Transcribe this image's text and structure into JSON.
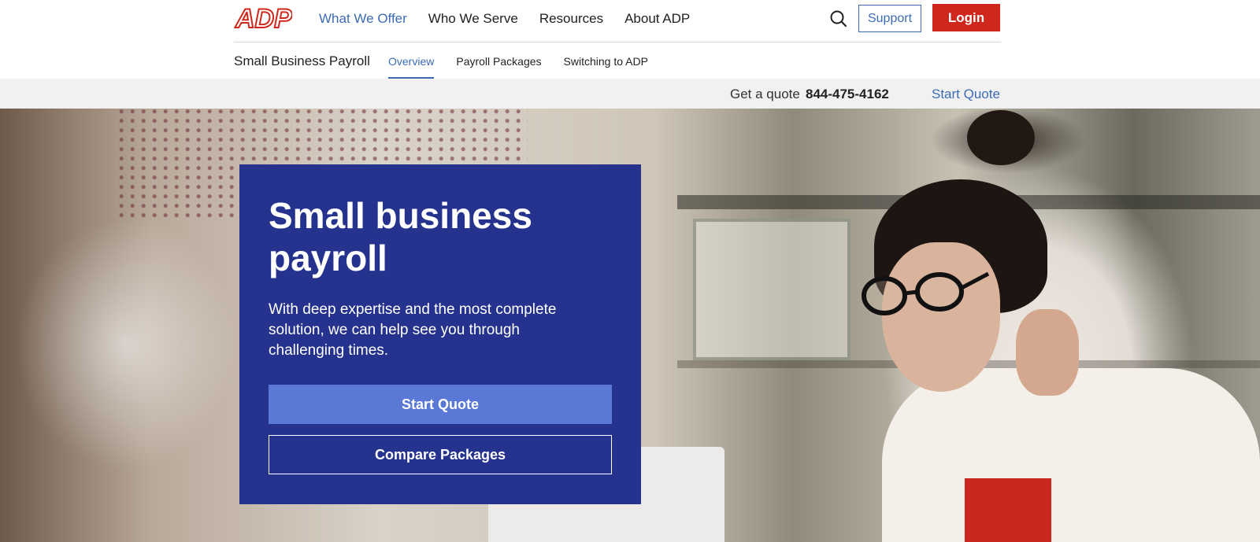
{
  "brand": {
    "logo_text": "ADP",
    "accent": "#d0271d",
    "link_color": "#3d6bb5",
    "card_color": "#26338e"
  },
  "topnav": {
    "links": [
      {
        "label": "What We Offer",
        "active": true
      },
      {
        "label": "Who We Serve",
        "active": false
      },
      {
        "label": "Resources",
        "active": false
      },
      {
        "label": "About ADP",
        "active": false
      }
    ],
    "search_icon": "search-icon",
    "support_label": "Support",
    "login_label": "Login"
  },
  "subnav": {
    "title": "Small Business Payroll",
    "tabs": [
      {
        "label": "Overview",
        "active": true
      },
      {
        "label": "Payroll Packages",
        "active": false
      },
      {
        "label": "Switching to ADP",
        "active": false
      }
    ]
  },
  "quotebar": {
    "label": "Get a quote",
    "phone": "844-475-4162",
    "link": "Start Quote"
  },
  "hero": {
    "title": "Small business payroll",
    "description": "With deep expertise and the most complete solution, we can help see you through challenging times.",
    "primary_button": "Start Quote",
    "secondary_button": "Compare Packages"
  }
}
